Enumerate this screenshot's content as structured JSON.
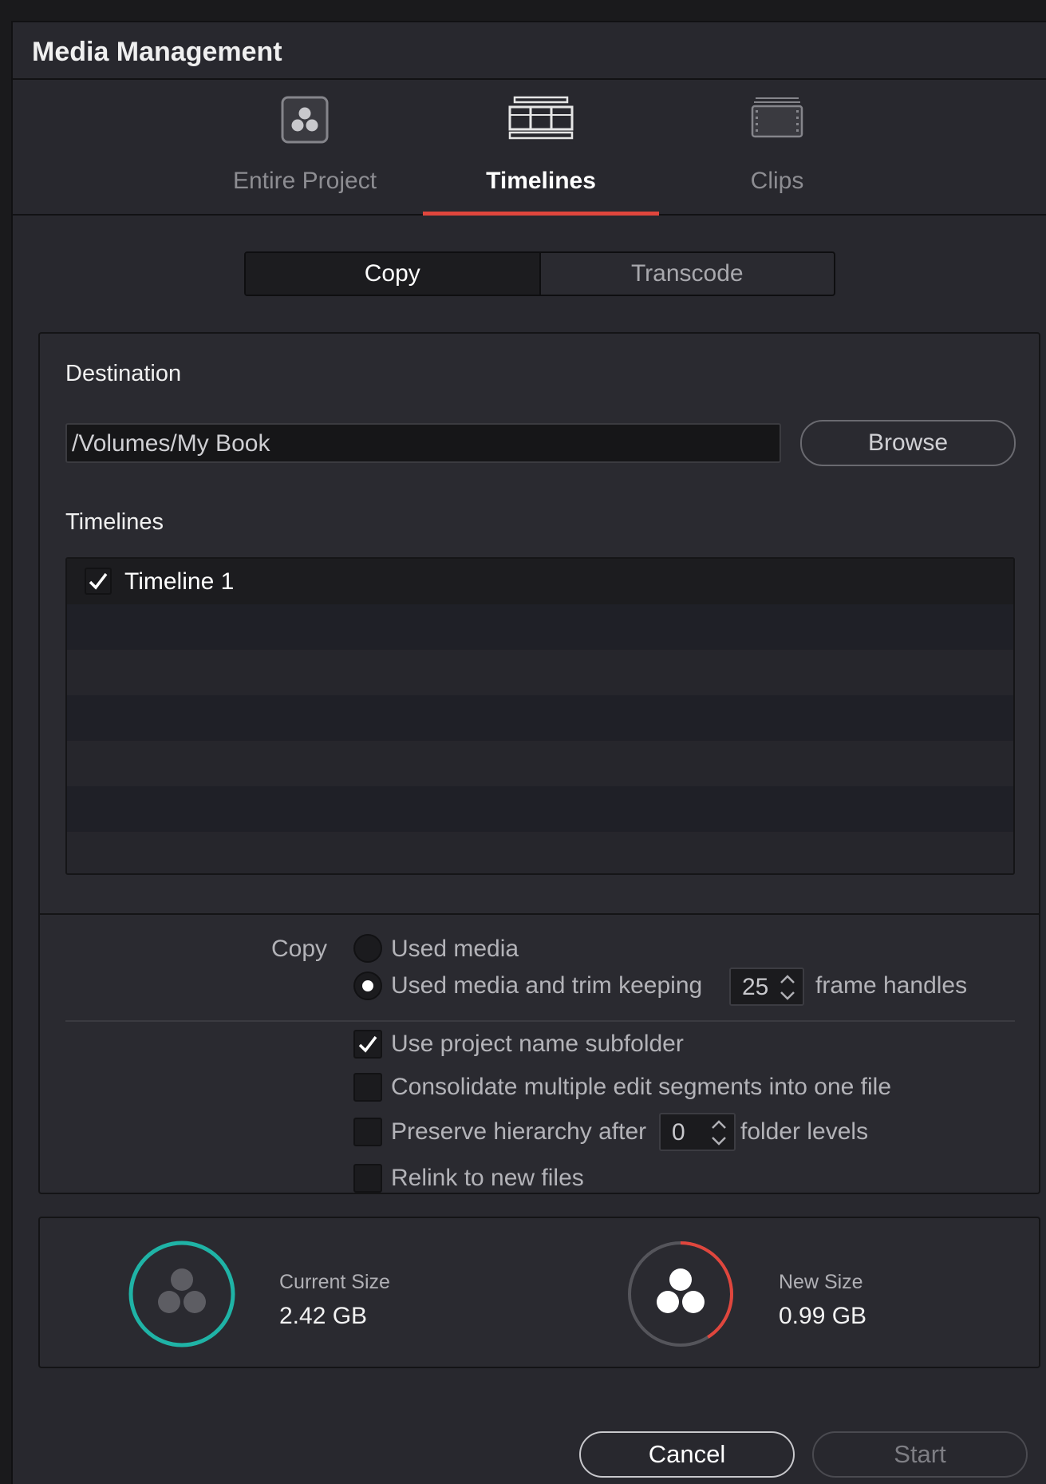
{
  "window": {
    "title": "Media Management"
  },
  "tabs": [
    {
      "label": "Entire Project",
      "icon": "resolve-logo-icon",
      "active": false
    },
    {
      "label": "Timelines",
      "icon": "timeline-icon",
      "active": true
    },
    {
      "label": "Clips",
      "icon": "clip-filmstrip-icon",
      "active": false
    }
  ],
  "mode": {
    "options": [
      "Copy",
      "Transcode"
    ],
    "selected": "Copy"
  },
  "destination": {
    "label": "Destination",
    "path": "/Volumes/My Book",
    "browse_label": "Browse"
  },
  "timelines": {
    "label": "Timelines",
    "items": [
      {
        "name": "Timeline 1",
        "checked": true
      }
    ]
  },
  "copy_options": {
    "label": "Copy",
    "used_media": "Used media",
    "trim_prefix": "Used media and trim keeping",
    "frame_handles": "25",
    "trim_suffix": "frame handles",
    "selected": "trim"
  },
  "checkboxes": {
    "subfolder": {
      "label": "Use project name subfolder",
      "checked": true
    },
    "consolidate": {
      "label": "Consolidate multiple edit segments into one file",
      "checked": false
    },
    "preserve_prefix": "Preserve hierarchy after",
    "preserve_levels": "0",
    "preserve_suffix": "folder levels",
    "preserve_checked": false,
    "relink": {
      "label": "Relink to new files",
      "checked": false
    }
  },
  "sizes": {
    "current_label": "Current Size",
    "current_value": "2.42 GB",
    "new_label": "New Size",
    "new_value": "0.99 GB",
    "new_fraction": 0.41
  },
  "footer": {
    "cancel": "Cancel",
    "start": "Start"
  },
  "colors": {
    "accent": "#e0463d",
    "teal": "#1fb3a6",
    "panel": "#2a2a30"
  }
}
